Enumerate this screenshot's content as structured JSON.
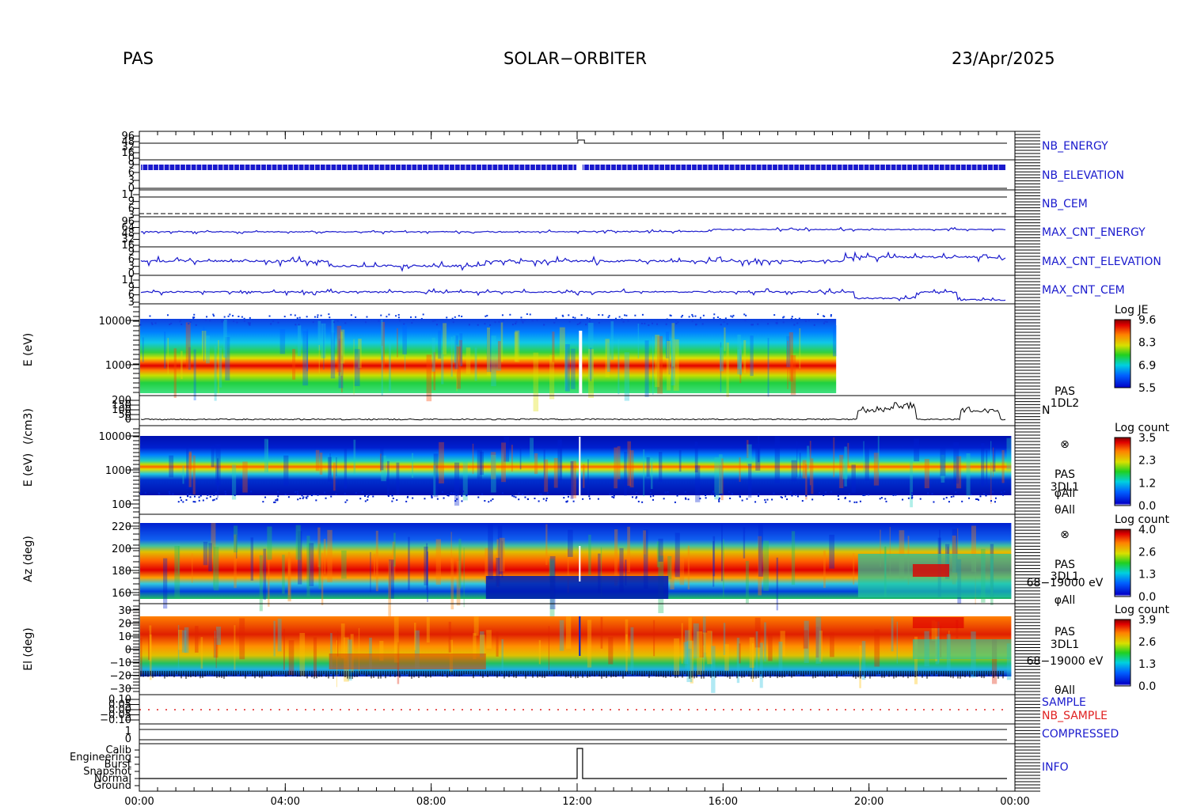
{
  "header": {
    "left": "PAS",
    "center": "SOLAR−ORBITER",
    "right": "23/Apr/2025"
  },
  "colors": {
    "trace": "#1a1acd",
    "black": "#000000",
    "red": "#e02020"
  },
  "chart_data": {
    "type": "multi-panel time series / spectrogram",
    "x_ticks": [
      "00:00",
      "04:00",
      "08:00",
      "12:00",
      "16:00",
      "20:00",
      "00:00"
    ],
    "x_range_hours": [
      0,
      24
    ],
    "panels": [
      {
        "id": "nb_energy",
        "label": "NB_ENERGY",
        "tick_labels": [
          "96",
          "48",
          "32",
          "16",
          "0"
        ]
      },
      {
        "id": "nb_elevation",
        "label": "NB_ELEVATION",
        "tick_labels": [
          "9",
          "6",
          "3",
          "0"
        ]
      },
      {
        "id": "nb_cem",
        "label": "NB_CEM",
        "tick_labels": [
          "11",
          "9",
          "6",
          "3"
        ]
      },
      {
        "id": "max_cnt_energy",
        "label": "MAX_CNT_ENERGY",
        "tick_labels": [
          "96",
          "64",
          "48",
          "32",
          "16"
        ]
      },
      {
        "id": "max_cnt_elevation",
        "label": "MAX_CNT_ELEVATION",
        "tick_labels": [
          "9",
          "6",
          "3",
          "0"
        ]
      },
      {
        "id": "max_cnt_cem",
        "label": "MAX_CNT_CEM",
        "tick_labels": [
          "11",
          "9",
          "6",
          "3"
        ]
      },
      {
        "id": "spec_je",
        "ylabel": "E (eV)",
        "y_ticks": [
          "10000",
          "1000"
        ],
        "colorbar": {
          "title": "Log JE",
          "ticks": [
            "9.6",
            "8.3",
            "6.9",
            "5.5"
          ]
        },
        "data_end_hours": 19.1
      },
      {
        "id": "density",
        "ylabel": "(/cm3)",
        "y_ticks": [
          "200",
          "150",
          "100",
          "50",
          "0"
        ],
        "side_labels": [
          "PAS",
          "1DL2"
        ],
        "trace_label": "N"
      },
      {
        "id": "spec_energy",
        "ylabel": "E (eV)",
        "y_ticks": [
          "10000",
          "1000",
          "100"
        ],
        "colorbar": {
          "title": "Log count",
          "ticks": [
            "3.5",
            "2.3",
            "1.2",
            "0.0"
          ]
        },
        "side_labels": [
          "⊗",
          "PAS",
          "3DL1",
          "φAll",
          "θAll"
        ]
      },
      {
        "id": "spec_az",
        "ylabel": "Az (deg)",
        "y_ticks": [
          "220",
          "200",
          "180",
          "160"
        ],
        "colorbar": {
          "title": "Log count",
          "ticks": [
            "4.0",
            "2.6",
            "1.3",
            "0.0"
          ]
        },
        "side_labels": [
          "⊗",
          "PAS",
          "3DL1",
          "68−19000 eV",
          "φAll"
        ]
      },
      {
        "id": "spec_el",
        "ylabel": "El (deg)",
        "y_ticks": [
          "30",
          "20",
          "10",
          "0",
          "−10",
          "−20",
          "−30"
        ],
        "colorbar": {
          "title": "Log count",
          "ticks": [
            "3.9",
            "2.6",
            "1.3",
            "0.0"
          ]
        },
        "side_labels": [
          "PAS",
          "3DL1",
          "68−19000 eV",
          "θAll"
        ]
      },
      {
        "id": "sample",
        "labels": [
          "SAMPLE",
          "NB_SAMPLE"
        ],
        "tick_labels": [
          "0.10",
          "0.05",
          "0.00",
          "−0.05",
          "−0.10"
        ]
      },
      {
        "id": "compressed",
        "label": "COMPRESSED",
        "tick_labels": [
          "1",
          "0"
        ]
      },
      {
        "id": "info",
        "label": "INFO",
        "tick_labels": [
          "Calib",
          "Engineering",
          "Burst",
          "Snapshot",
          "Normal",
          "Ground"
        ]
      }
    ]
  }
}
